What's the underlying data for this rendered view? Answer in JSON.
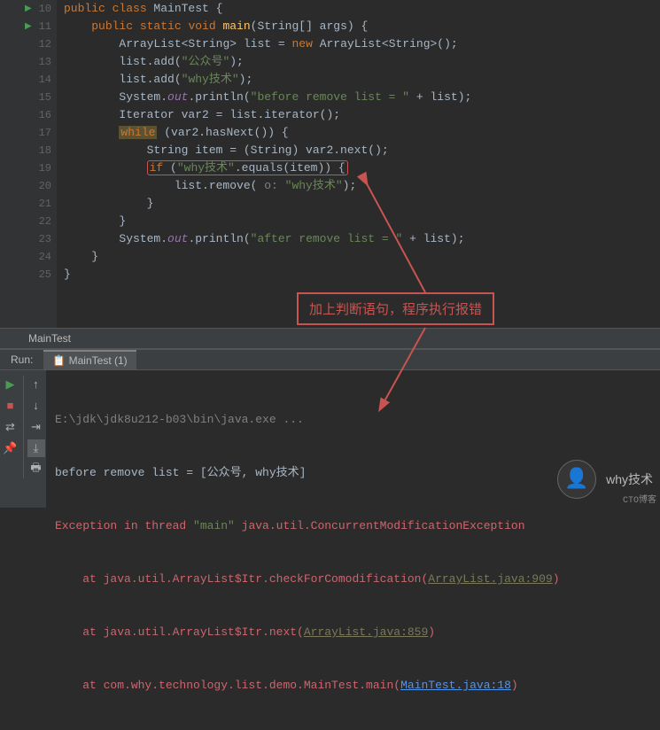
{
  "gutter": {
    "lines": [
      "10",
      "11",
      "12",
      "13",
      "14",
      "15",
      "16",
      "17",
      "18",
      "19",
      "20",
      "21",
      "22",
      "23",
      "24",
      "25"
    ],
    "run_markers": [
      0,
      1
    ]
  },
  "code": {
    "l10": {
      "kw1": "public class",
      "cls": " MainTest ",
      "br": "{"
    },
    "l11": {
      "kw1": "public static ",
      "kw2": "void ",
      "m": "main",
      "args": "(String[] args) {"
    },
    "l12": {
      "decl": "ArrayList<String> list = ",
      "kw": "new ",
      "ctor": "ArrayList<String>();"
    },
    "l13": {
      "call": "list.add(",
      "str": "\"公众号\"",
      "close": ");"
    },
    "l14": {
      "call": "list.add(",
      "str": "\"why技术\"",
      "close": ");"
    },
    "l15": {
      "sys": "System.",
      "out": "out",
      "pr": ".println(",
      "str": "\"before remove list = \"",
      "plus": " + list);"
    },
    "l16": {
      "decl": "Iterator var2 = list.iterator();"
    },
    "l17": {
      "kw": "while",
      "cond": " (var2.hasNext()) {"
    },
    "l18": {
      "decl": "String item = (String) var2.next();"
    },
    "l19": {
      "kw": "if ",
      "open": "(",
      "str": "\"why技术\"",
      "eq": ".equals(item)) {"
    },
    "l20": {
      "call": "list.remove( ",
      "param": "o: ",
      "str": "\"why技术\"",
      "close": ");"
    },
    "l21": {
      "br": "}"
    },
    "l22": {
      "br": "}"
    },
    "l23": {
      "sys": "System.",
      "out": "out",
      "pr": ".println(",
      "str": "\"after remove list = \"",
      "plus": " + list);"
    },
    "l24": {
      "br": "}"
    },
    "l25": {
      "br": "}"
    }
  },
  "annotation": "加上判断语句，程序执行报错",
  "tabs": {
    "editor": "MainTest"
  },
  "run": {
    "label": "Run:",
    "tab": "MainTest (1)"
  },
  "console": {
    "cmd": "E:\\jdk\\jdk8u212-b03\\bin\\java.exe ...",
    "out": "before remove list = [公众号, why技术]",
    "err1_a": "Exception in thread ",
    "err1_b": "\"main\"",
    "err1_c": " java.util.ConcurrentModificationException",
    "err2_a": "    at java.util.ArrayList$Itr.checkForComodification(",
    "err2_b": "ArrayList.java:909",
    "err2_c": ")",
    "err3_a": "    at java.util.ArrayList$Itr.next(",
    "err3_b": "ArrayList.java:859",
    "err3_c": ")",
    "err4_a": "    at com.why.technology.list.demo.MainTest.main(",
    "err4_b": "MainTest.java:18",
    "err4_c": ")"
  },
  "watermark": {
    "text": "why技术",
    "sub": "CTO博客"
  }
}
